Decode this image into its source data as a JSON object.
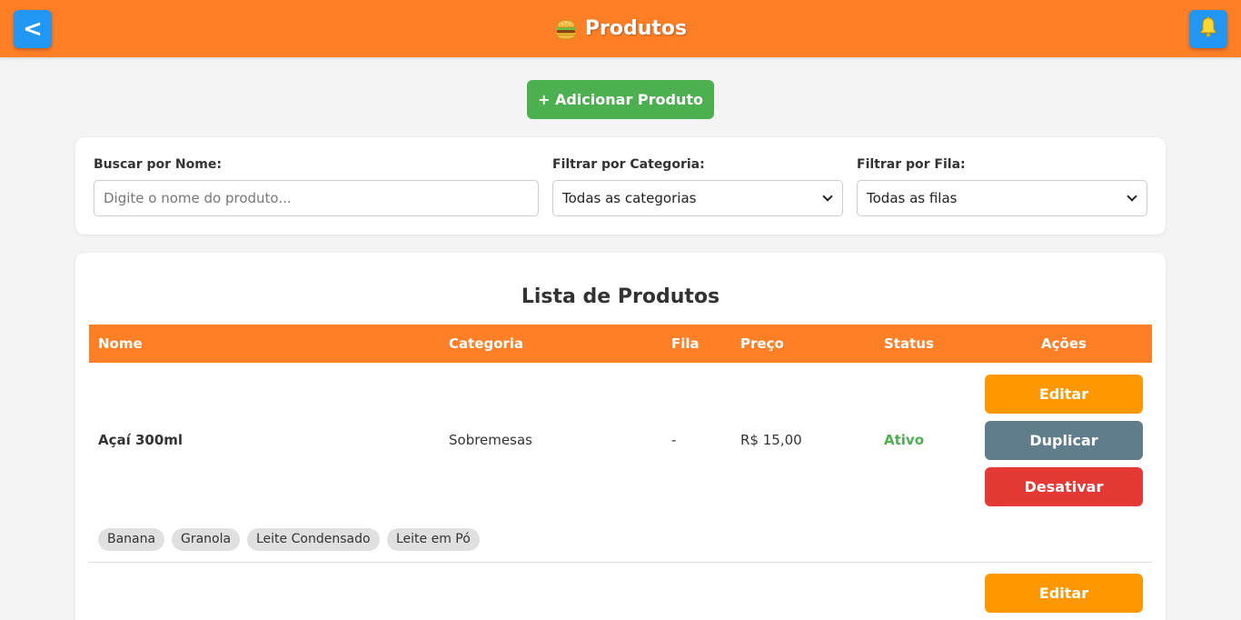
{
  "header": {
    "back_label": "<",
    "title": "Produtos",
    "title_icon": "burger-icon",
    "bell_icon": "bell-icon"
  },
  "toolbar": {
    "add_product_label": "+ Adicionar Produto"
  },
  "filters": {
    "name_label": "Buscar por Nome:",
    "name_placeholder": "Digite o nome do produto...",
    "name_value": "",
    "category_label": "Filtrar por Categoria:",
    "category_selected": "Todas as categorias",
    "queue_label": "Filtrar por Fila:",
    "queue_selected": "Todas as filas"
  },
  "list": {
    "title": "Lista de Produtos",
    "columns": [
      "Nome",
      "Categoria",
      "Fila",
      "Preço",
      "Status",
      "Ações"
    ],
    "rows": [
      {
        "name": "Açaí 300ml",
        "category": "Sobremesas",
        "queue": "-",
        "price": "R$ 15,00",
        "status": "Ativo",
        "actions": [
          "Editar",
          "Duplicar",
          "Desativar"
        ],
        "tags": [
          "Banana",
          "Granola",
          "Leite Condensado",
          "Leite em Pó"
        ]
      },
      {
        "actions": [
          "Editar"
        ]
      }
    ]
  },
  "colors": {
    "header": "#ff7f27",
    "accent_blue": "#2196f3",
    "add_green": "#4caf50",
    "edit_orange": "#ff9800",
    "duplicate_gray": "#607d8b",
    "deactivate_red": "#e53935",
    "status_active": "#4caf50"
  }
}
